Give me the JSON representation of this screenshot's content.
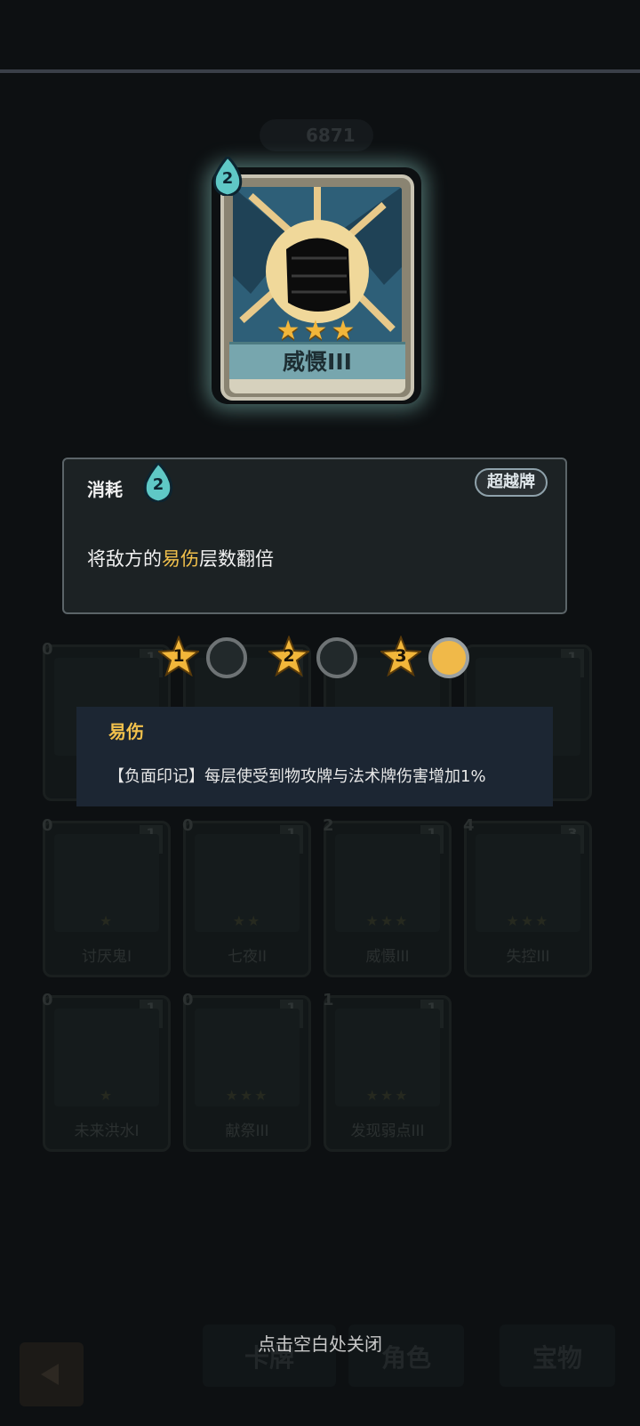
{
  "currency": {
    "value": "6871"
  },
  "featured_card": {
    "cost": "2",
    "name": "威慑III",
    "stars": "★★★"
  },
  "detail": {
    "cost_label": "消耗",
    "cost": "2",
    "badge": "超越牌",
    "desc_prefix": "将敌方的",
    "desc_keyword": "易伤",
    "desc_suffix": "层数翻倍"
  },
  "levels": [
    {
      "num": "1",
      "active": false
    },
    {
      "num": "2",
      "active": false
    },
    {
      "num": "3",
      "active": true
    }
  ],
  "tooltip": {
    "title": "易伤",
    "text": "【负面印记】每层使受到物攻牌与法术牌伤害增加1%"
  },
  "deck": [
    {
      "cost": "0",
      "count": "1",
      "name": "",
      "stars": ""
    },
    {
      "cost": "",
      "count": "1",
      "name": "",
      "stars": ""
    },
    {
      "cost": "",
      "count": "",
      "name": "",
      "stars": ""
    },
    {
      "cost": "",
      "count": "1",
      "name": "",
      "stars": ""
    },
    {
      "cost": "0",
      "count": "1",
      "name": "讨厌鬼I",
      "stars": "★"
    },
    {
      "cost": "0",
      "count": "1",
      "name": "七夜II",
      "stars": "★★"
    },
    {
      "cost": "2",
      "count": "1",
      "name": "威慑III",
      "stars": "★★★"
    },
    {
      "cost": "4",
      "count": "3",
      "name": "失控III",
      "stars": "★★★"
    },
    {
      "cost": "0",
      "count": "1",
      "name": "未来洪水I",
      "stars": "★"
    },
    {
      "cost": "0",
      "count": "1",
      "name": "献祭III",
      "stars": "★★★"
    },
    {
      "cost": "1",
      "count": "1",
      "name": "发现弱点III",
      "stars": "★★★"
    }
  ],
  "tabs": [
    "卡牌",
    "角色",
    "宝物"
  ],
  "close_hint": "点击空白处关闭",
  "colors": {
    "accent": "#f2c14c",
    "panel": "#1c2224",
    "tooltip": "#1c2633"
  }
}
